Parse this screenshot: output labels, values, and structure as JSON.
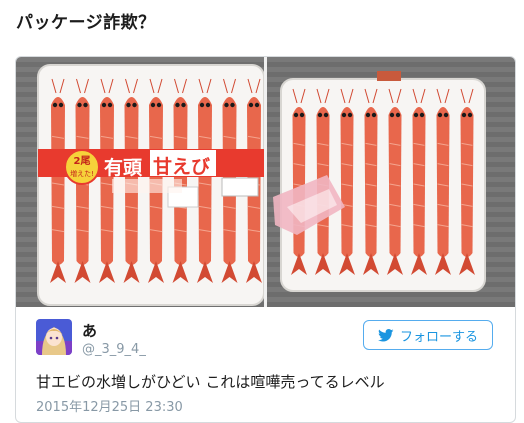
{
  "headline": "パッケージ詐欺？",
  "package_label": {
    "badge_line1": "2尾",
    "badge_line2": "増えた!",
    "brand_part1": "有頭",
    "brand_part2": "甘えび"
  },
  "user": {
    "name": "あ",
    "handle": "@_3_9_4_"
  },
  "follow_button": {
    "label": "フォローする",
    "icon": "twitter-bird-icon"
  },
  "tweet": {
    "text": "甘エビの水増しがひどい これは喧嘩売ってるレベル",
    "date": "2015年12月25日 23:30"
  },
  "colors": {
    "accent": "#1b95e0",
    "label_red": "#e83a2e",
    "shrimp": "#e8674c",
    "tray": "#f7f5f3"
  }
}
